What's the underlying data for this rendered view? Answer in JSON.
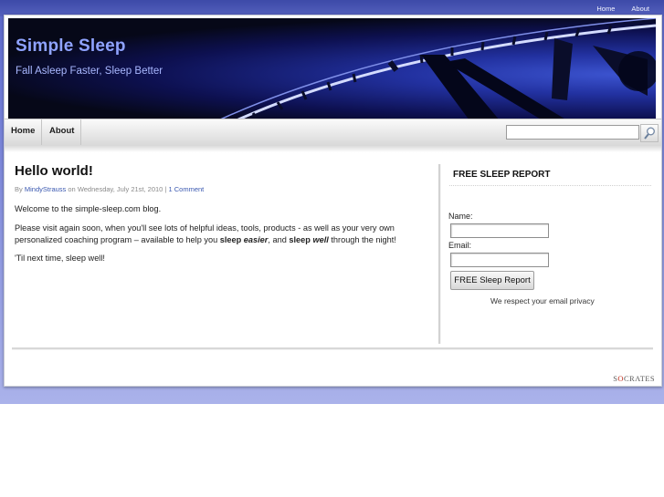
{
  "top_nav": {
    "items": [
      "Home",
      "About"
    ]
  },
  "header": {
    "title": "Simple Sleep",
    "tagline": "Fall Asleep Faster, Sleep Better"
  },
  "main_nav": {
    "items": [
      "Home",
      "About"
    ]
  },
  "search": {
    "placeholder": "",
    "button_icon": "magnifier-icon"
  },
  "post": {
    "title": "Hello world!",
    "meta": {
      "by": "By",
      "author": "MindyStrauss",
      "on": "on Wednesday, July 21st, 2010 |",
      "comments": "1 Comment"
    },
    "p1": "Welcome to the simple-sleep.com blog.",
    "p2_start": "Please visit again soon, when you'll see lots of helpful ideas, tools, products - as well as your very own personalized coaching program – available to help you ",
    "p2_sleep1": "sleep",
    "p2_easier": "easier",
    "p2_and": ", and ",
    "p2_sleep2": "sleep",
    "p2_well": "well",
    "p2_end": " through the night!",
    "p3": "'Til next time, sleep well!"
  },
  "sidebar": {
    "widget_title": "FREE SLEEP REPORT",
    "name_label": "Name:",
    "email_label": "Email:",
    "submit_label": "FREE Sleep Report",
    "privacy_note": "We respect your email privacy"
  },
  "footer": {
    "brand_pre": "S",
    "brand_o": "O",
    "brand_post": "CRATES"
  },
  "colors": {
    "band": "#6c78d4",
    "title": "#8fa3ff",
    "link": "#3a58b0",
    "brand_accent": "#c03020"
  }
}
